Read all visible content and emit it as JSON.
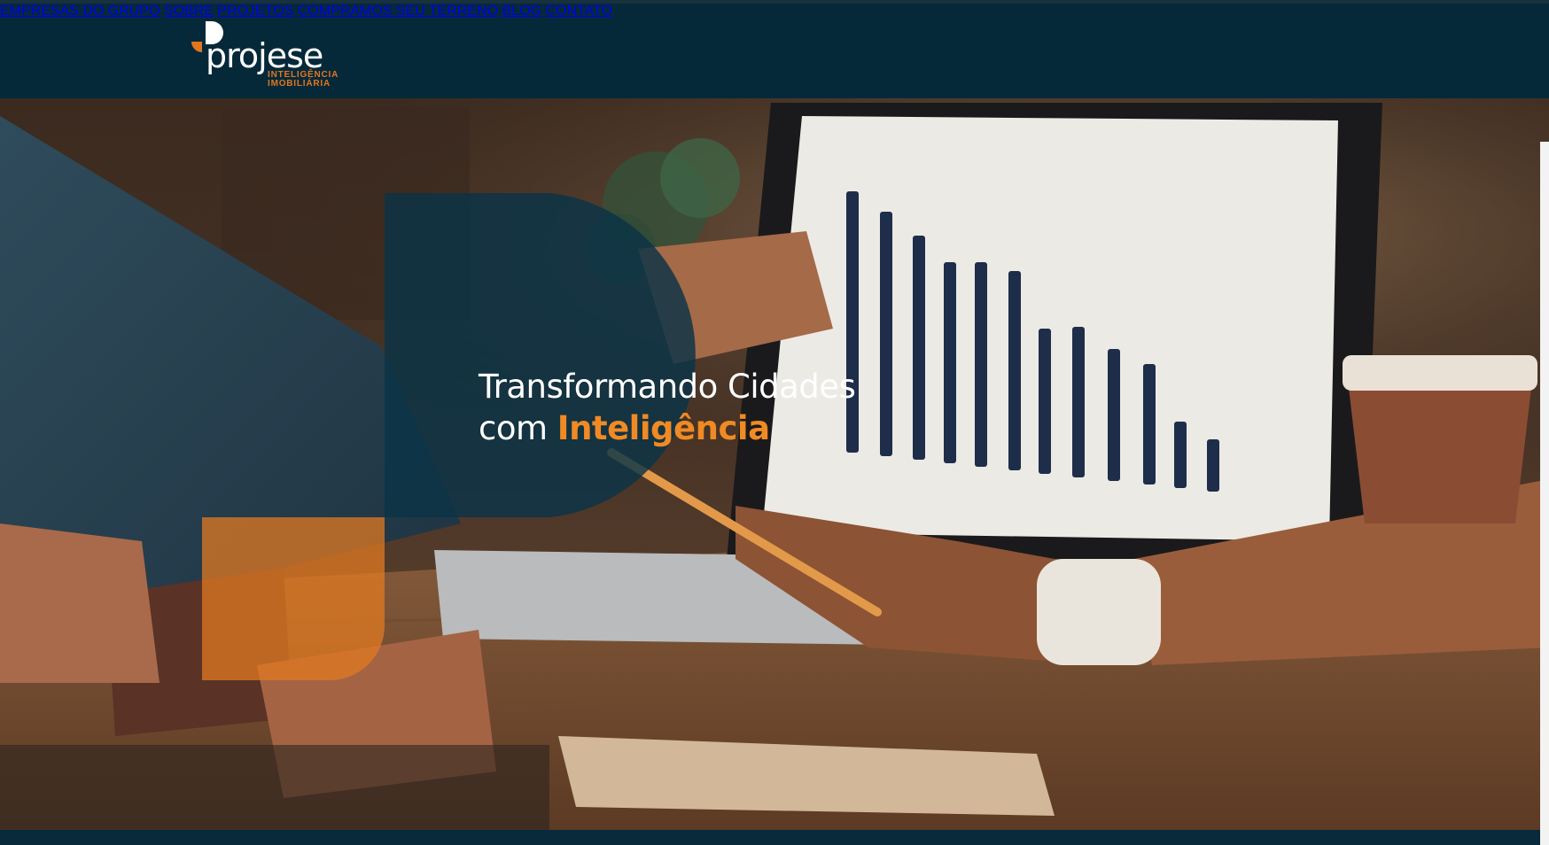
{
  "brand": {
    "name": "projese",
    "tagline_line1": "INTELIGÊNCIA",
    "tagline_line2": "IMOBILIÁRIA",
    "accent_color": "#e17520",
    "nav_bg": "#06293a"
  },
  "nav": {
    "items": [
      {
        "label": "EMPRESAS DO GRUPO"
      },
      {
        "label": "SOBRE"
      },
      {
        "label": "PROJETOS"
      },
      {
        "label": "COMPRAMOS SEU TERRENO"
      },
      {
        "label": "BLOG"
      },
      {
        "label": "CONTATO"
      }
    ]
  },
  "hero": {
    "headline_line1": "Transformando Cidades",
    "headline_line2_prefix": "com ",
    "headline_line2_highlight": "Inteligência",
    "highlight_color": "#f08a24"
  }
}
